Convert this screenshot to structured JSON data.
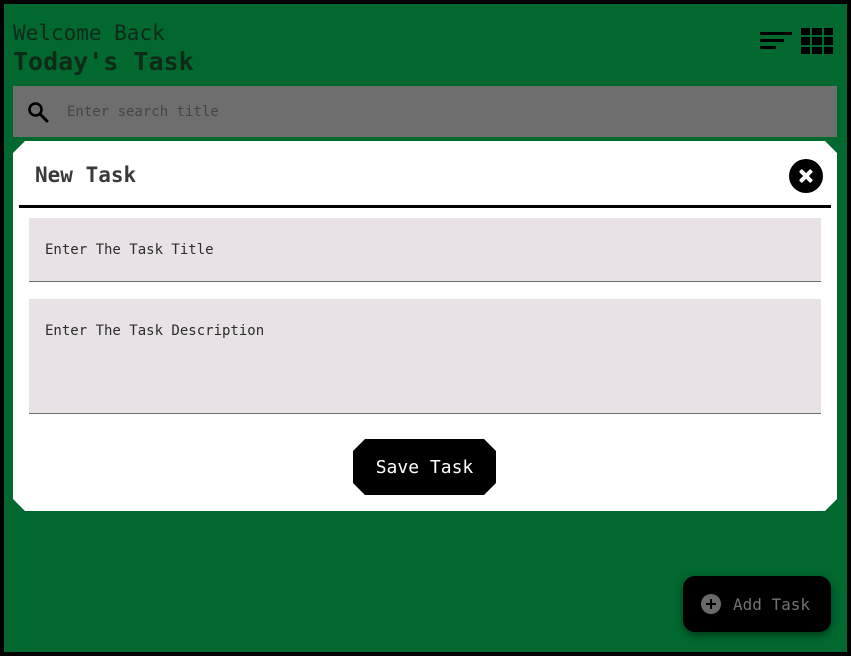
{
  "header": {
    "welcome": "Welcome Back",
    "title": "Today's Task",
    "sort_icon": "sort-icon",
    "grid_icon": "grid-view-icon"
  },
  "search": {
    "placeholder": "Enter search title",
    "icon": "search-icon"
  },
  "modal": {
    "title": "New Task",
    "close_icon": "close-icon",
    "title_placeholder": "Enter The Task Title",
    "description_placeholder": "Enter The Task Description",
    "save_label": "Save Task"
  },
  "fab": {
    "label": "Add Task",
    "icon": "plus-circle-icon"
  },
  "colors": {
    "background": "#016830",
    "modal": "#ffffff",
    "field": "#e8e2e6",
    "button": "#000000"
  }
}
